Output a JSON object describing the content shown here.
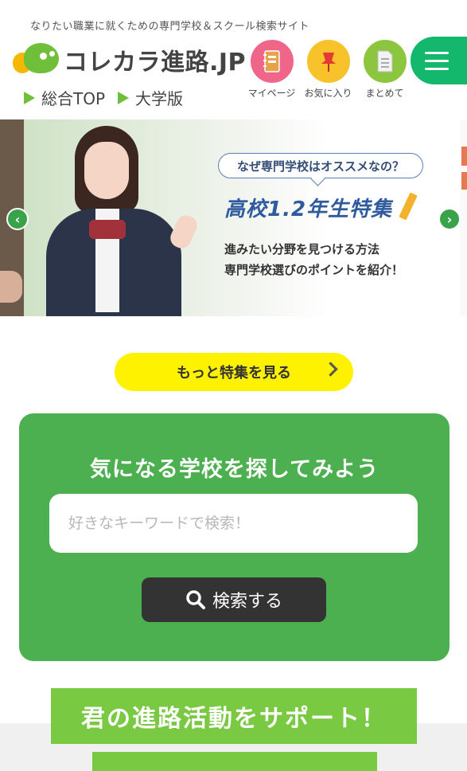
{
  "header": {
    "tagline": "なりたい職業に就くための専門学校＆スクール検索サイト",
    "logo_text": "コレカラ進路.JP",
    "links": [
      {
        "label": "総合TOP"
      },
      {
        "label": "大学版"
      }
    ],
    "icons": [
      {
        "label": "マイページ",
        "icon": "notebook-icon",
        "color": "#f0668a"
      },
      {
        "label": "お気に入り",
        "icon": "pushpin-icon",
        "color": "#f7c22a"
      },
      {
        "label": "まとめて",
        "icon": "document-icon",
        "color": "#8cc63f"
      }
    ],
    "menu_color": "#13b86d"
  },
  "carousel": {
    "bubble_text": "なぜ専門学校はオススメなの？",
    "title": "高校1.2年生特集",
    "desc_line1": "進みたい分野を見つける方法",
    "desc_line2": "専門学校選びのポイントを紹介！"
  },
  "more_button": {
    "label": "もっと特集を見る"
  },
  "search": {
    "title": "気になる学校を探してみよう",
    "placeholder": "好きなキーワードで検索！",
    "value": "",
    "button_label": "検索する"
  },
  "support_banner": {
    "label": "君の進路活動をサポート！"
  },
  "colors": {
    "accent_green": "#4caf50",
    "banner_green": "#7ac943",
    "yellow": "#fff200"
  }
}
